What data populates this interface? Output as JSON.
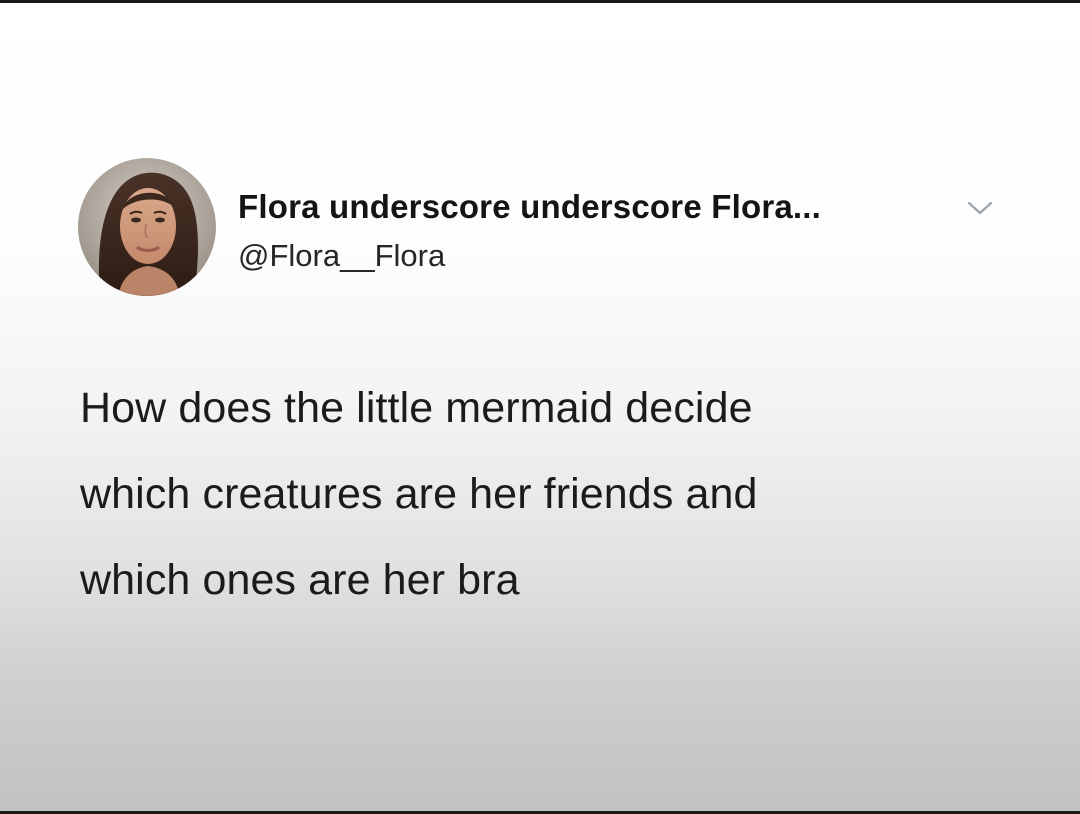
{
  "tweet": {
    "author": {
      "display_name": "Flora underscore underscore Flora...",
      "handle": "@Flora__Flora",
      "avatar_icon": "profile-photo"
    },
    "menu_icon": "chevron-down-icon",
    "text_lines": [
      "How does the little mermaid decide",
      "which creatures are her friends and",
      "which ones are her bra"
    ]
  },
  "colors": {
    "text": "#141414",
    "chevron": "#9aa4ad"
  }
}
